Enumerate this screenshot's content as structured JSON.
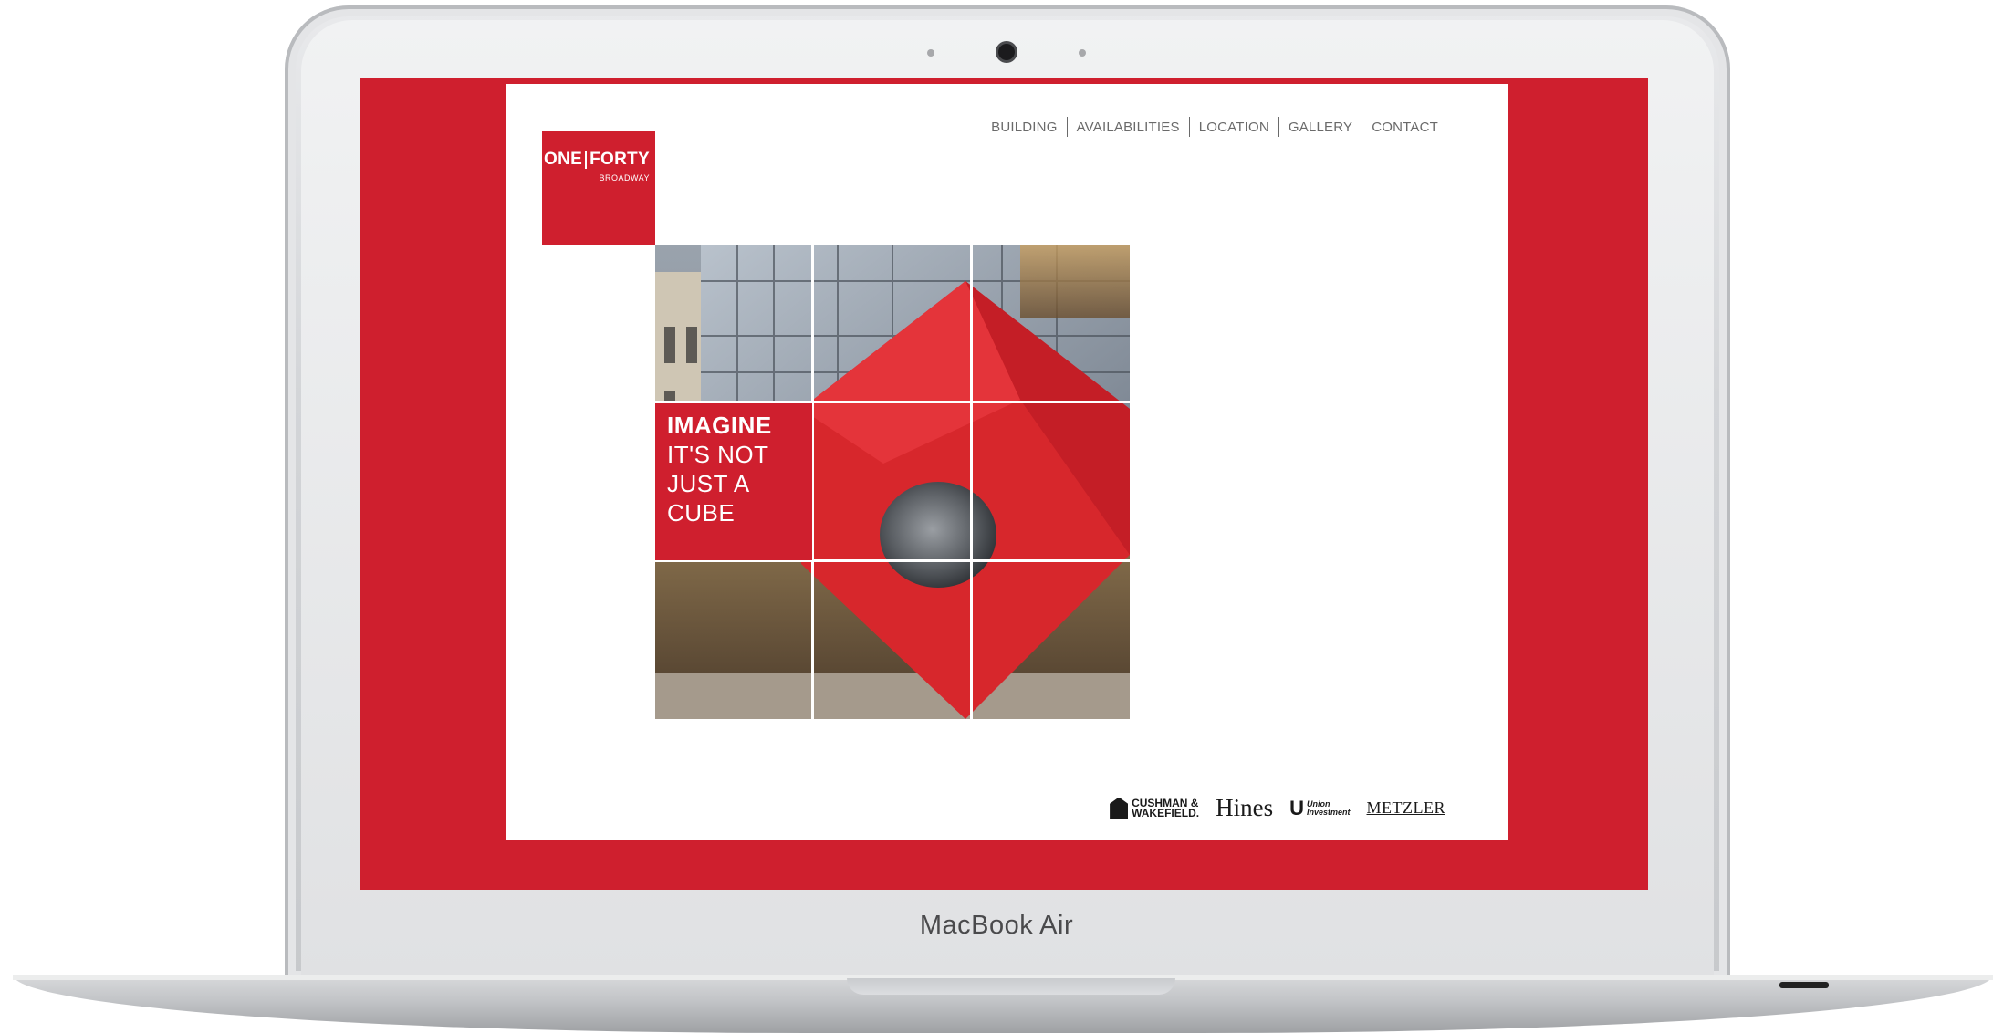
{
  "device": {
    "label": "MacBook Air"
  },
  "site": {
    "logo": {
      "word1": "ONE",
      "word2": "FORTY",
      "sub": "BROADWAY"
    },
    "nav": [
      {
        "label": "BUILDING"
      },
      {
        "label": "AVAILABILITIES"
      },
      {
        "label": "LOCATION"
      },
      {
        "label": "GALLERY"
      },
      {
        "label": "CONTACT"
      }
    ],
    "hero": {
      "lines": [
        "IMAGINE",
        "IT'S NOT",
        "JUST A",
        "CUBE"
      ]
    },
    "partners": {
      "cushman_line1": "CUSHMAN &",
      "cushman_line2": "WAKEFIELD.",
      "hines": "Hines",
      "union_mark": "U",
      "union_line1": "Union",
      "union_line2": "Investment",
      "metzler": "METZLER"
    },
    "colors": {
      "brand_red": "#cf1f2e",
      "nav_text": "#6a6a6a"
    }
  }
}
